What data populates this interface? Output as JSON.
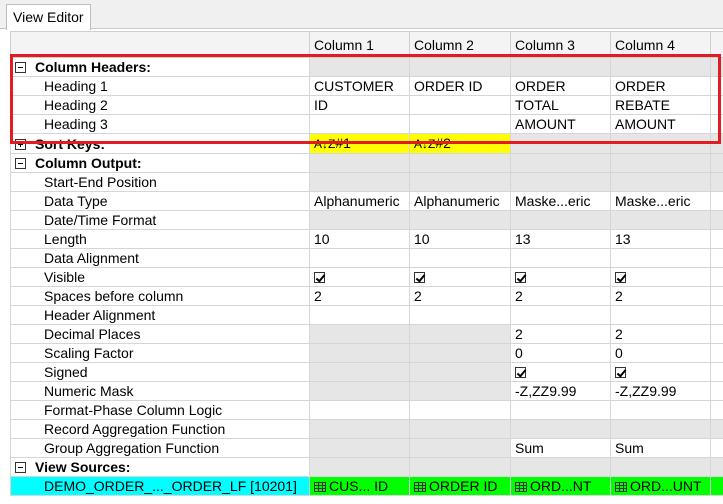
{
  "tab": {
    "label": "View Editor"
  },
  "columns": [
    "Column 1",
    "Column 2",
    "Column 3",
    "Column 4"
  ],
  "groups": {
    "column_headers": "Column Headers:",
    "sort_keys": "Sort Keys:",
    "column_output": "Column Output:",
    "view_sources": "View Sources:"
  },
  "headings": [
    {
      "label": "Heading 1",
      "values": [
        "CUSTOMER",
        "ORDER ID",
        "ORDER",
        "ORDER"
      ]
    },
    {
      "label": "Heading 2",
      "values": [
        "ID",
        "",
        "TOTAL",
        "REBATE"
      ]
    },
    {
      "label": "Heading 3",
      "values": [
        "",
        "",
        "AMOUNT",
        "AMOUNT"
      ]
    }
  ],
  "sort_keys": [
    "#1",
    "#2"
  ],
  "output_rows": {
    "start_end_position": "Start-End  Position",
    "data_type": {
      "label": "Data Type",
      "values": [
        "Alphanumeric",
        "Alphanumeric",
        "Maske...eric",
        "Maske...eric"
      ]
    },
    "date_time_format": "Date/Time Format",
    "length": {
      "label": "Length",
      "values": [
        "10",
        "10",
        "13",
        "13"
      ]
    },
    "data_alignment": "Data Alignment",
    "visible": {
      "label": "Visible",
      "values": [
        true,
        true,
        true,
        true
      ]
    },
    "spaces_before": {
      "label": "Spaces before column",
      "values": [
        "2",
        "2",
        "2",
        "2"
      ]
    },
    "header_alignment": "Header Alignment",
    "decimal_places": {
      "label": "Decimal Places",
      "values": [
        "2",
        "2"
      ]
    },
    "scaling_factor": {
      "label": "Scaling Factor",
      "values": [
        "0",
        "0"
      ]
    },
    "signed": {
      "label": "Signed",
      "values": [
        true,
        true
      ]
    },
    "numeric_mask": {
      "label": "Numeric Mask",
      "values": [
        "-Z,ZZ9.99",
        "-Z,ZZ9.99"
      ]
    },
    "format_phase_logic": "Format-Phase Column Logic",
    "record_aggregation": "Record Aggregation Function",
    "group_aggregation": {
      "label": "Group Aggregation Function",
      "values": [
        "Sum",
        "Sum"
      ]
    }
  },
  "view_source": {
    "name": "DEMO_ORDER_..._ORDER_LF [10201]",
    "values": [
      "CUS... ID",
      "ORDER ID",
      "ORD...NT",
      "ORD...UNT"
    ]
  },
  "colors": {
    "highlight_box": "#e31b23",
    "sort_key": "#ffff00",
    "source_row": "#00ffff",
    "source_cells": "#00ff00",
    "disabled_cell": "#e6e6e6"
  }
}
